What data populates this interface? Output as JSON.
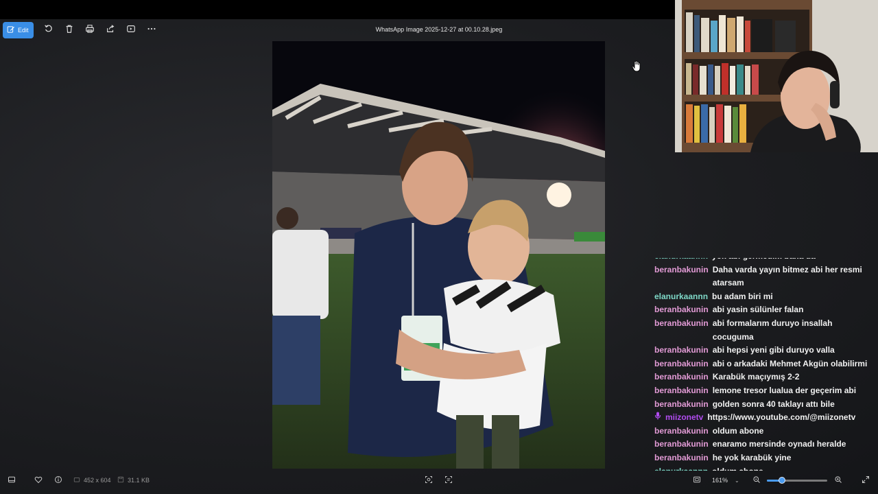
{
  "viewer": {
    "filename": "WhatsApp Image 2025-12-27 at 00.10.28.jpeg",
    "toolbar": {
      "edit_label": "Edit"
    },
    "status": {
      "dimensions": "452 x 604",
      "filesize": "31.1 KB",
      "zoom": "161%",
      "zoom_fraction": 0.25
    }
  },
  "chat": {
    "colors": {
      "beranbakunin": "#e39bd6",
      "elanurkaannn": "#7fd9c8",
      "miizonetv": "#b14cf0"
    },
    "messages": [
      {
        "user": "elanurkaannn",
        "text": "yok abi germedim bana da"
      },
      {
        "user": "beranbakunin",
        "text": "Daha varda yayın bitmez abi her resmi atarsam"
      },
      {
        "user": "elanurkaannn",
        "text": "bu adam biri mi"
      },
      {
        "user": "beranbakunin",
        "text": "abi yasin sülünler falan"
      },
      {
        "user": "beranbakunin",
        "text": "abi formalarım duruyo insallah cocuguma"
      },
      {
        "user": "beranbakunin",
        "text": "abi hepsi yeni gibi duruyo valla"
      },
      {
        "user": "beranbakunin",
        "text": "abi o arkadaki Mehmet Akgün olabilirmi"
      },
      {
        "user": "beranbakunin",
        "text": "Karabük maçıymış 2-2"
      },
      {
        "user": "beranbakunin",
        "text": "lemone tresor lualua der geçerim abi"
      },
      {
        "user": "beranbakunin",
        "text": "golden sonra 40 taklayı attı bile"
      },
      {
        "user": "miizonetv",
        "text": "https://www.youtube.com/@miizonetv",
        "badge": "microphone-icon"
      },
      {
        "user": "beranbakunin",
        "text": "oldum abone"
      },
      {
        "user": "beranbakunin",
        "text": "enaramo mersinde oynadı heralde"
      },
      {
        "user": "beranbakunin",
        "text": "he yok karabük yine"
      },
      {
        "user": "elanurkaannn",
        "text": "oldum abone"
      }
    ]
  }
}
